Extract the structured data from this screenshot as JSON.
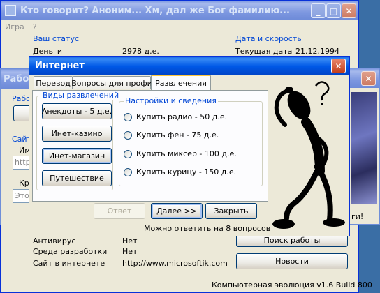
{
  "main_window": {
    "title": "Кто говорит? Аноним... Хм, дал же Бог фамилию...",
    "menu": [
      "Игра",
      "?"
    ],
    "status_group": "Ваш статус",
    "money_label": "Деньги",
    "money_value": "2978 д.е.",
    "date_group": "Дата и скорость",
    "date_label": "Текущая дата",
    "date_value": "21.12.1994",
    "rows": [
      {
        "label": "Антивирус",
        "value": "Нет"
      },
      {
        "label": "Среда разработки",
        "value": "Нет"
      },
      {
        "label": "Сайт в интернете",
        "value": "http://www.microsoftik.com"
      }
    ],
    "search_work_button": "Поиск работы",
    "news_button": "Новости",
    "version": "Компьютерная эволюция v1.6 Build 800"
  },
  "work_window": {
    "title_fragment": "Работ",
    "group1_fragment": "Рабо",
    "group2_fragment": "Сайт",
    "label_im": "Им",
    "input1_fragment": "http:",
    "label_kr": "Кр",
    "input2_fragment": "Этот"
  },
  "right_window": {
    "fragment": "ги!"
  },
  "internet_dialog": {
    "title": "Интернет",
    "tabs": [
      "Перевод",
      "Вопросы для профи",
      "Развлечения"
    ],
    "kinds_group": "Виды развлечений",
    "kinds": [
      "Анекдоты - 5 д.е.",
      "Инет-казино",
      "Инет-магазин",
      "Путешествие"
    ],
    "settings_group": "Настройки и сведения",
    "options": [
      "Купить радио - 50 д.е.",
      "Купить фен - 75 д.е.",
      "Купить миксер - 100 д.е.",
      "Купить курицу - 150 д.е."
    ],
    "answer_button": "Ответ",
    "next_button": "Далее >>",
    "close_button": "Закрыть",
    "info": "Можно ответить на 8 вопросов"
  },
  "colors": {
    "accent": "#0046d5",
    "title_active": "#0058e6",
    "close": "#c4401c"
  }
}
